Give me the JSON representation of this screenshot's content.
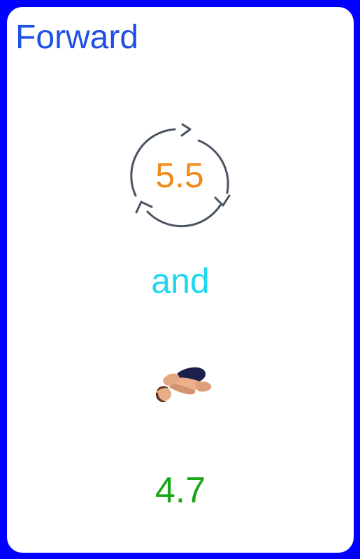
{
  "card": {
    "title": "Forward",
    "rotation": {
      "icon": "rotate-cycle-icon",
      "value": "5.5",
      "value_color": "#f28a1a"
    },
    "connector": "and",
    "position": {
      "icon": "tuck-position-diver-icon"
    },
    "score": "4.7"
  },
  "colors": {
    "border": "#0000ff",
    "title": "#1e50e6",
    "connector": "#1ed8f0",
    "score": "#1aa81a",
    "icon_stroke": "#4a5563"
  }
}
